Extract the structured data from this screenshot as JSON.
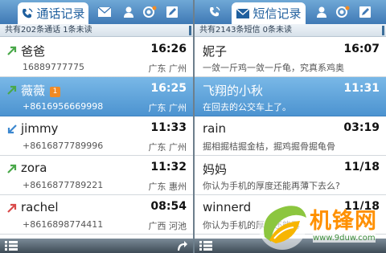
{
  "call_log": {
    "tab_label": "通话记录",
    "summary": "共有202条通话 1条未读",
    "entries": [
      {
        "name": "爸爸",
        "time": "16:26",
        "number": "16889777775",
        "location": "广东 广州",
        "type": "outgoing",
        "selected": false,
        "badge": ""
      },
      {
        "name": "薇薇",
        "time": "16:25",
        "number": "+8616956669998",
        "location": "广东 广州",
        "type": "outgoing",
        "selected": true,
        "badge": "1"
      },
      {
        "name": "jimmy",
        "time": "11:33",
        "number": "+8616877789996",
        "location": "广东 广州",
        "type": "incoming",
        "selected": false,
        "badge": ""
      },
      {
        "name": "zora",
        "time": "11:32",
        "number": "+8616877789221",
        "location": "广东 惠州",
        "type": "outgoing",
        "selected": false,
        "badge": ""
      },
      {
        "name": "rachel",
        "time": "08:54",
        "number": "+8616898774411",
        "location": "广西 河池",
        "type": "missed",
        "selected": false,
        "badge": ""
      }
    ]
  },
  "messages": {
    "tab_label": "短信记录",
    "summary": "共有2143条短信 0条未读",
    "entries": [
      {
        "name": "妮子",
        "time": "16:07",
        "snippet": "一敛一斤鸡一敛一斤龟，究真系鸡奥",
        "selected": false
      },
      {
        "name": "飞翔的小秋",
        "time": "11:31",
        "snippet": "在回去的公交车上了。",
        "selected": true
      },
      {
        "name": "rain",
        "time": "03:19",
        "snippet": "掘相掘桔掘金桔，掘鸡掘骨掘龟骨",
        "selected": false
      },
      {
        "name": "妈妈",
        "time": "11/18",
        "snippet": "你认为手机的厚度还能再薄下去么?",
        "selected": false
      },
      {
        "name": "winnerd",
        "time": "11/18",
        "snippet": "你认为手机的厚度还能再",
        "selected": false
      }
    ]
  },
  "watermark": {
    "logo_text": "机锋网",
    "url": "www.9duw.com"
  },
  "colors": {
    "tab_bar": "#3f79b5",
    "selection": "#4c93d0",
    "outgoing_arrow": "#4aa84a",
    "incoming_arrow": "#3b87cf",
    "missed_arrow": "#d94a4a",
    "badge": "#f08a24"
  }
}
